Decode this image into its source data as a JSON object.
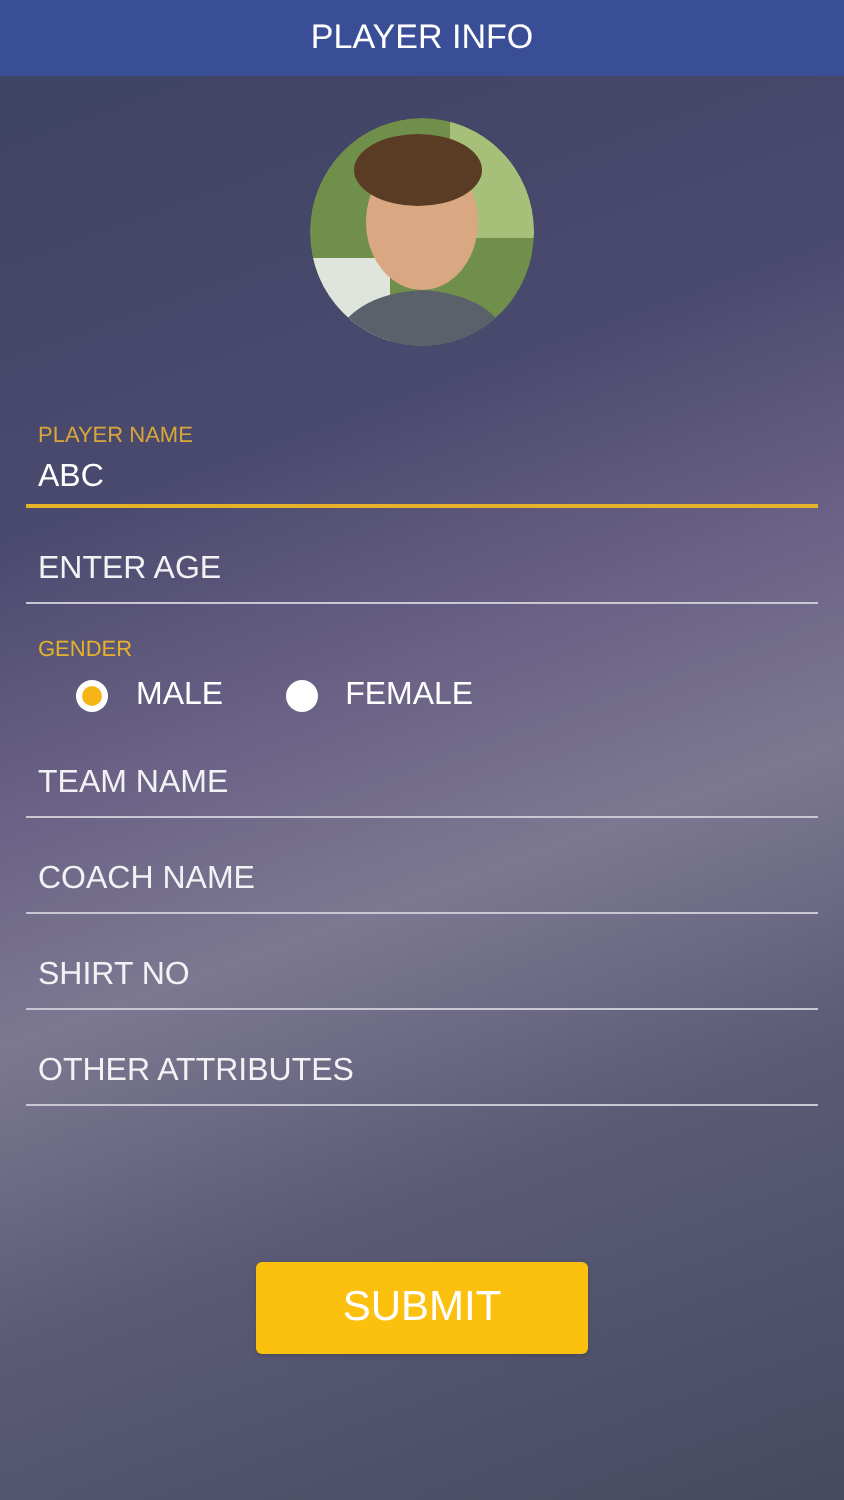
{
  "header": {
    "title": "PLAYER INFO"
  },
  "fields": [
    {
      "kind": "text",
      "label": "PLAYER NAME",
      "value": "ABC",
      "focused": true
    },
    {
      "kind": "input",
      "placeholder": "ENTER AGE",
      "focused": false
    },
    {
      "kind": "radio_group",
      "label": "GENDER",
      "options": [
        {
          "label": "MALE",
          "selected": true
        },
        {
          "label": "FEMALE",
          "selected": false
        }
      ]
    },
    {
      "kind": "input",
      "placeholder": "TEAM NAME",
      "focused": false
    },
    {
      "kind": "input",
      "placeholder": "COACH NAME",
      "focused": false
    },
    {
      "kind": "input",
      "placeholder": "SHIRT NO",
      "focused": false
    },
    {
      "kind": "input",
      "placeholder": "OTHER ATTRIBUTES",
      "focused": false
    }
  ],
  "submit": {
    "label": "SUBMIT"
  }
}
